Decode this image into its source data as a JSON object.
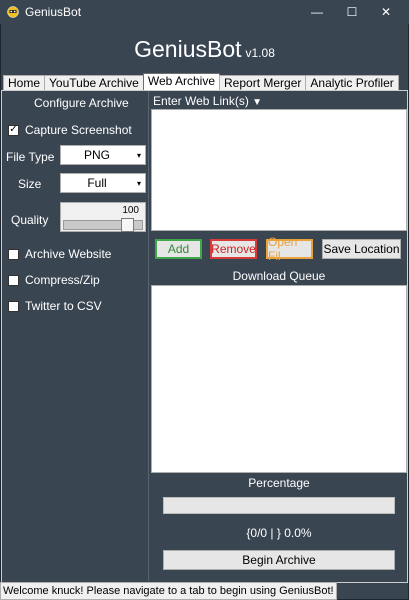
{
  "window": {
    "title": "GeniusBot",
    "minimize": "—",
    "maximize": "☐",
    "close": "✕"
  },
  "header": {
    "app_name": "GeniusBot",
    "version": "v1.08"
  },
  "tabs": [
    {
      "label": "Home",
      "active": false
    },
    {
      "label": "YouTube Archive",
      "active": false
    },
    {
      "label": "Web Archive",
      "active": true
    },
    {
      "label": "Report Merger",
      "active": false
    },
    {
      "label": "Analytic Profiler",
      "active": false
    }
  ],
  "configure": {
    "title": "Configure Archive",
    "capture_screenshot": {
      "label": "Capture Screenshot",
      "checked": true,
      "mark": "✓"
    },
    "file_type": {
      "label": "File Type",
      "value": "PNG"
    },
    "size": {
      "label": "Size",
      "value": "Full"
    },
    "quality": {
      "label": "Quality",
      "value": 100,
      "display": "100"
    },
    "archive_website": {
      "label": "Archive Website",
      "checked": false
    },
    "compress_zip": {
      "label": "Compress/Zip",
      "checked": false
    },
    "twitter_csv": {
      "label": "Twitter to CSV",
      "checked": false
    }
  },
  "links": {
    "label": "Enter Web Link(s)",
    "arrow": "▼"
  },
  "buttons": {
    "add": "Add",
    "remove": "Remove",
    "open_file": "Open Fil",
    "save_location": "Save Location",
    "begin_archive": "Begin Archive"
  },
  "queue": {
    "title": "Download Queue"
  },
  "progress": {
    "title": "Percentage",
    "value": 0,
    "status": "{0/0 | } 0.0%"
  },
  "status_bar": {
    "message": "Welcome knuck! Please navigate to a tab to begin using GeniusBot!"
  },
  "icons": {
    "app": "robot-icon",
    "dropdown": "▾"
  },
  "colors": {
    "background": "#3a4552",
    "add": "#3fa649",
    "remove": "#d93a3a",
    "open_file": "#e8a33d"
  }
}
